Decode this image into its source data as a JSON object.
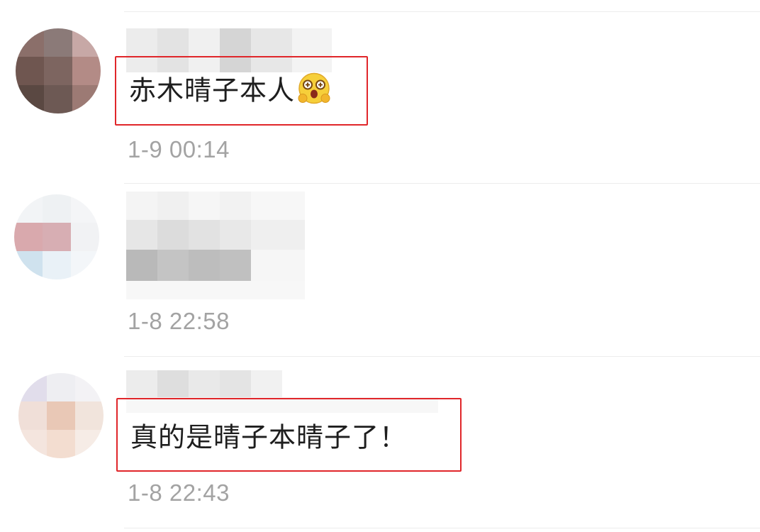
{
  "comments": [
    {
      "text": "赤木晴子本人",
      "emoji": "surprised-face-emoji",
      "time": "1-9 00:14",
      "highlighted": true
    },
    {
      "time": "1-8 22:58",
      "highlighted": false
    },
    {
      "text": "真的是晴子本晴子了！",
      "time": "1-8 22:43",
      "highlighted": true
    }
  ],
  "colors": {
    "highlight_border": "#e0262a",
    "timestamp": "#a3a3a3",
    "divider": "#ececec"
  }
}
